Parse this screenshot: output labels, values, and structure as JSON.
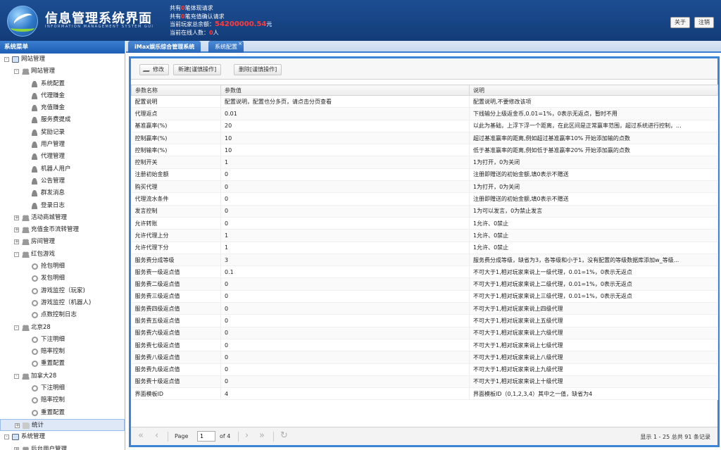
{
  "header": {
    "title": "信息管理系统界面",
    "subtitle": "INFORMATION MANAGEMENT SYSTEM GUI",
    "stats": [
      {
        "pre": "共有",
        "val": "0",
        "post": "笔体现请求"
      },
      {
        "pre": "共有",
        "val": "0",
        "post": "笔充值确认请求"
      },
      {
        "pre": "当前玩家总余额：",
        "val": "54200000.54",
        "post": "元"
      },
      {
        "pre": "当前在线人数：",
        "val": "0",
        "post": "人"
      }
    ],
    "about_label": "关于",
    "logout_label": "注销"
  },
  "sidebar": {
    "title": "系统菜单",
    "nodes": [
      {
        "label": "网站管理",
        "depth": 0,
        "icon": "monitor-icon",
        "toggle": "-"
      },
      {
        "label": "网站管理",
        "depth": 1,
        "icon": "group-icon",
        "toggle": "-"
      },
      {
        "label": "系统配置",
        "depth": 2,
        "icon": "user-icon"
      },
      {
        "label": "代理赚金",
        "depth": 2,
        "icon": "user-icon"
      },
      {
        "label": "充值赚金",
        "depth": 2,
        "icon": "user-icon"
      },
      {
        "label": "服务费提成",
        "depth": 2,
        "icon": "user-icon"
      },
      {
        "label": "奖励记录",
        "depth": 2,
        "icon": "user-icon"
      },
      {
        "label": "用户管理",
        "depth": 2,
        "icon": "user-icon"
      },
      {
        "label": "代理管理",
        "depth": 2,
        "icon": "user-icon"
      },
      {
        "label": "机器人用户",
        "depth": 2,
        "icon": "user-icon"
      },
      {
        "label": "公告管理",
        "depth": 2,
        "icon": "user-icon"
      },
      {
        "label": "群发消息",
        "depth": 2,
        "icon": "user-icon"
      },
      {
        "label": "登录日志",
        "depth": 2,
        "icon": "user-icon"
      },
      {
        "label": "活动商城管理",
        "depth": 1,
        "icon": "group-icon",
        "toggle": "+"
      },
      {
        "label": "充值金币流转管理",
        "depth": 1,
        "icon": "group-icon",
        "toggle": "+"
      },
      {
        "label": "房间管理",
        "depth": 1,
        "icon": "group-icon",
        "toggle": "+"
      },
      {
        "label": "红包游戏",
        "depth": 1,
        "icon": "group-icon",
        "toggle": "-"
      },
      {
        "label": "抢包明细",
        "depth": 2,
        "icon": "cog-icon"
      },
      {
        "label": "发包明细",
        "depth": 2,
        "icon": "cog-icon"
      },
      {
        "label": "游戏监控（玩家)",
        "depth": 2,
        "icon": "cog-icon"
      },
      {
        "label": "游戏监控（机器人)",
        "depth": 2,
        "icon": "cog-icon"
      },
      {
        "label": "点数控制日志",
        "depth": 2,
        "icon": "cog-icon"
      },
      {
        "label": "北京28",
        "depth": 1,
        "icon": "group-icon",
        "toggle": "-"
      },
      {
        "label": "下注明细",
        "depth": 2,
        "icon": "cog-icon"
      },
      {
        "label": "赔率控制",
        "depth": 2,
        "icon": "cog-icon"
      },
      {
        "label": "重置配置",
        "depth": 2,
        "icon": "cog-icon"
      },
      {
        "label": "加拿大28",
        "depth": 1,
        "icon": "group-icon",
        "toggle": "-"
      },
      {
        "label": "下注明细",
        "depth": 2,
        "icon": "cog-icon"
      },
      {
        "label": "赔率控制",
        "depth": 2,
        "icon": "cog-icon"
      },
      {
        "label": "重置配置",
        "depth": 2,
        "icon": "cog-icon"
      },
      {
        "label": "统计",
        "depth": 1,
        "icon": "folder-icon",
        "toggle": "+",
        "selected": true
      },
      {
        "label": "系统管理",
        "depth": 0,
        "icon": "monitor-icon",
        "toggle": "-"
      },
      {
        "label": "后台用户管理",
        "depth": 1,
        "icon": "group-icon",
        "toggle": "+"
      }
    ]
  },
  "tabs": [
    {
      "label": "iMax娱乐综合管理系统"
    },
    {
      "label": "系统配置"
    }
  ],
  "toolbar": {
    "edit_label": "修改",
    "new_label": "新建[谨慎操作]",
    "delete_label": "删除[谨慎操作]"
  },
  "grid": {
    "columns": [
      "参数名称",
      "参数值",
      "说明"
    ],
    "rows": [
      [
        "配置说明",
        "配置说明，配置也分多页，请点击分页查看",
        "配置说明,不要修改该项"
      ],
      [
        "代理返点",
        "0.01",
        "下线输分上级返金币,0.01=1%，0表示无返点，暂时不用"
      ],
      [
        "基准赢率(%)",
        "20",
        "以此为基础，上浮下浮一个距离，在此区间是正常赢率范围，超过系统进行控制，..."
      ],
      [
        "控制赢率(%)",
        "10",
        "超过基准赢率的距离,例如超过基准赢率10% 开始添加输的点数"
      ],
      [
        "控制输率(%)",
        "10",
        "低于基准赢率的距离,例如低于基准赢率20% 开始添加赢的点数"
      ],
      [
        "控制开关",
        "1",
        "1为打开，0为关闭"
      ],
      [
        "注册初始金额",
        "0",
        "注册即赠送的初始金额,填0表示不赠送"
      ],
      [
        "购买代理",
        "0",
        "1为打开，0为关闭"
      ],
      [
        "代理流水条件",
        "0",
        "注册即赠送的初始金额,填0表示不赠送"
      ],
      [
        "发言控制",
        "0",
        "1为可以发言，0为禁止发言"
      ],
      [
        "允许转账",
        "0",
        "1允许、0禁止"
      ],
      [
        "允许代理上分",
        "1",
        "1允许、0禁止"
      ],
      [
        "允许代理下分",
        "1",
        "1允许、0禁止"
      ],
      [
        "服务费分成等级",
        "3",
        "服务费分成等级，缺省为3，各等级和小于1，没有配置的等级数据库添加w_等级..."
      ],
      [
        "服务费一级返点值",
        "0.1",
        "不可大于1,相对玩家来说上一级代理，0.01=1%，0表示无返点"
      ],
      [
        "服务费二级返点值",
        "0",
        "不可大于1,相对玩家来说上二级代理，0.01=1%，0表示无返点"
      ],
      [
        "服务费三级返点值",
        "0",
        "不可大于1,相对玩家来说上三级代理，0.01=1%，0表示无返点"
      ],
      [
        "服务费四级返点值",
        "0",
        "不可大于1,相对玩家来说上四级代理"
      ],
      [
        "服务费五级返点值",
        "0",
        "不可大于1,相对玩家来说上五级代理"
      ],
      [
        "服务费六级返点值",
        "0",
        "不可大于1,相对玩家来说上六级代理"
      ],
      [
        "服务费七级返点值",
        "0",
        "不可大于1,相对玩家来说上七级代理"
      ],
      [
        "服务费八级返点值",
        "0",
        "不可大于1,相对玩家来说上八级代理"
      ],
      [
        "服务费九级返点值",
        "0",
        "不可大于1,相对玩家来说上九级代理"
      ],
      [
        "服务费十级返点值",
        "0",
        "不可大于1,相对玩家来说上十级代理"
      ],
      [
        "界面模板ID",
        "4",
        "界面模板ID（0,1,2,3,4）其中之一值，缺省为4"
      ]
    ]
  },
  "pager": {
    "page_label": "Page",
    "page_value": "1",
    "of_label": "of 4",
    "summary": "显示 1 - 25 总共 91 条记录",
    "first_icon": "«",
    "prev_icon": "‹",
    "next_icon": "›",
    "last_icon": "»",
    "refresh_icon": "↻"
  }
}
